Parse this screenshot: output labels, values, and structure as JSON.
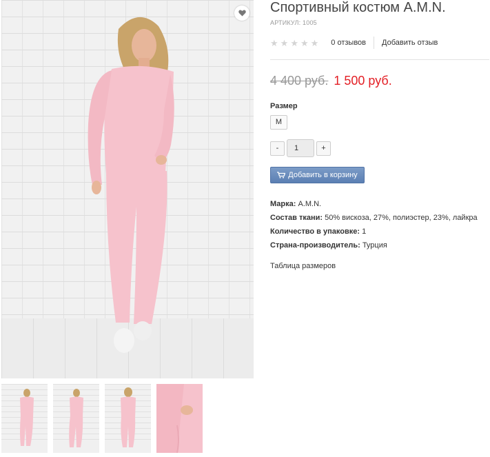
{
  "product": {
    "title": "Спортивный костюм A.M.N.",
    "sku": "АРТИКУЛ: 1005",
    "rating_stars": 0,
    "reviews_label": "0 отзывов",
    "add_review_label": "Добавить отзыв",
    "old_price": "4 400 руб.",
    "new_price": "1 500 руб.",
    "size_label": "Размер",
    "size_selected": "M",
    "qty_minus": "-",
    "qty_value": "1",
    "qty_plus": "+",
    "cart_button_label": "Добавить в корзину",
    "specs": [
      {
        "name": "Марка:",
        "value": "A.M.N."
      },
      {
        "name": "Состав ткани:",
        "value": "50% вискоза, 27%, полиэстер, 23%, лайкра"
      },
      {
        "name": "Количество в упаковке:",
        "value": "1"
      },
      {
        "name": "Страна-производитель:",
        "value": "Турция"
      }
    ],
    "size_table_link": "Таблица размеров"
  },
  "gallery": {
    "thumbnail_count": 4
  },
  "colors": {
    "accent_blue": "#5b7fb3",
    "sale_price": "#e31e24",
    "suit_pink": "#f6c2cc"
  }
}
